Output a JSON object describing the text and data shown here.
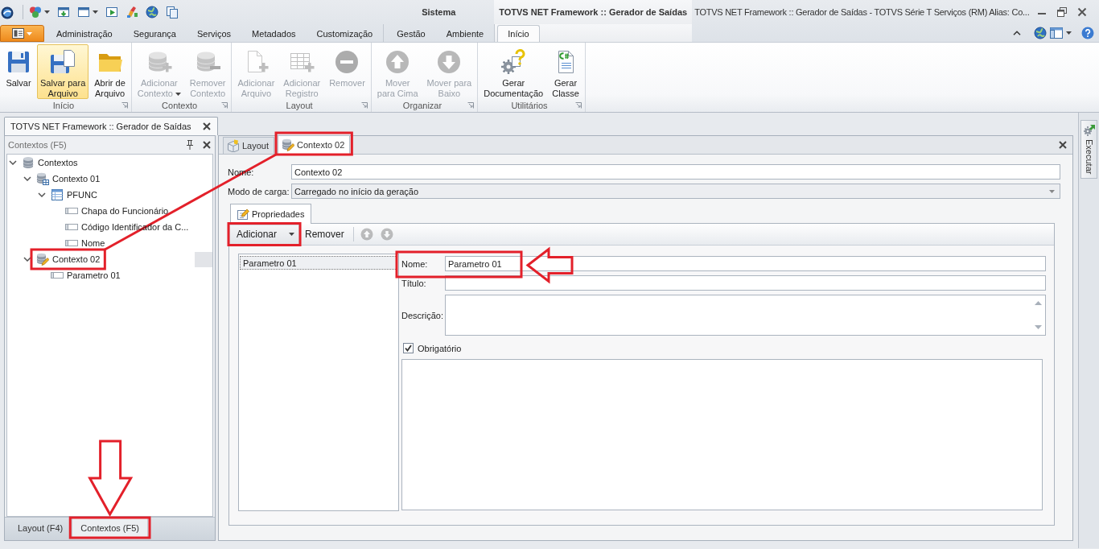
{
  "title_bar": {
    "title": "TOTVS NET Framework :: Gerador de Saídas - TOTVS Série T Serviços (RM) Alias: Co..."
  },
  "ribbon": {
    "tabs": [
      {
        "label": "Administração",
        "selected": false
      },
      {
        "label": "Segurança",
        "selected": false
      },
      {
        "label": "Serviços",
        "selected": false
      },
      {
        "label": "Metadados",
        "selected": false
      },
      {
        "label": "Customização",
        "selected": false
      }
    ],
    "tab_groups": [
      {
        "label": "Sistema",
        "tabs": [
          {
            "label": "Gestão",
            "selected": false
          },
          {
            "label": "Ambiente",
            "selected": false
          }
        ]
      },
      {
        "label": "TOTVS NET Framework :: Gerador de Saídas",
        "tabs": [
          {
            "label": "Início",
            "selected": true
          }
        ]
      }
    ],
    "groups": [
      {
        "label": "Início",
        "buttons": [
          {
            "label_lines": [
              "Salvar"
            ],
            "disabled": false,
            "highlighted": false,
            "dropdown": false
          },
          {
            "label_lines": [
              "Salvar para",
              "Arquivo"
            ],
            "disabled": false,
            "highlighted": true,
            "dropdown": false
          },
          {
            "label_lines": [
              "Abrir de",
              "Arquivo"
            ],
            "disabled": false,
            "highlighted": false,
            "dropdown": false
          }
        ]
      },
      {
        "label": "Contexto",
        "buttons": [
          {
            "label_lines": [
              "Adicionar",
              "Contexto"
            ],
            "disabled": true,
            "highlighted": false,
            "dropdown": true
          },
          {
            "label_lines": [
              "Remover",
              "Contexto"
            ],
            "disabled": true,
            "highlighted": false,
            "dropdown": false
          }
        ]
      },
      {
        "label": "Layout",
        "buttons": [
          {
            "label_lines": [
              "Adicionar",
              "Arquivo"
            ],
            "disabled": true,
            "highlighted": false,
            "dropdown": false
          },
          {
            "label_lines": [
              "Adicionar",
              "Registro"
            ],
            "disabled": true,
            "highlighted": false,
            "dropdown": false
          },
          {
            "label_lines": [
              "Remover"
            ],
            "disabled": true,
            "highlighted": false,
            "dropdown": false
          }
        ]
      },
      {
        "label": "Organizar",
        "buttons": [
          {
            "label_lines": [
              "Mover",
              "para Cima"
            ],
            "disabled": true,
            "highlighted": false,
            "dropdown": false
          },
          {
            "label_lines": [
              "Mover para",
              "Baixo"
            ],
            "disabled": true,
            "highlighted": false,
            "dropdown": false
          }
        ]
      },
      {
        "label": "Utilitários",
        "buttons": [
          {
            "label_lines": [
              "Gerar",
              "Documentação"
            ],
            "disabled": false,
            "highlighted": false,
            "dropdown": false
          },
          {
            "label_lines": [
              "Gerar",
              "Classe"
            ],
            "disabled": false,
            "highlighted": false,
            "dropdown": false
          }
        ]
      }
    ]
  },
  "document_tabs": [
    {
      "label": "TOTVS NET Framework :: Gerador de Saídas",
      "selected": true
    }
  ],
  "left_panel": {
    "title": "Contextos (F5)",
    "tree": [
      {
        "label": "Contextos",
        "kind": "root",
        "expanded": true,
        "selected": false,
        "children": [
          {
            "label": "Contexto 01",
            "kind": "datacontext",
            "expanded": true,
            "selected": false,
            "children": [
              {
                "label": "PFUNC",
                "kind": "table",
                "expanded": true,
                "selected": false,
                "children": [
                  {
                    "label": "Chapa do Funcionário",
                    "kind": "field",
                    "selected": false
                  },
                  {
                    "label": "Código Identificador da C...",
                    "kind": "field",
                    "selected": false
                  },
                  {
                    "label": "Nome",
                    "kind": "field",
                    "selected": false
                  }
                ]
              }
            ]
          },
          {
            "label": "Contexto 02",
            "kind": "paramcontext",
            "expanded": true,
            "selected": true,
            "children": [
              {
                "label": "Parametro 01",
                "kind": "field",
                "selected": false
              }
            ]
          }
        ]
      }
    ],
    "tabs": [
      {
        "label": "Layout (F4)",
        "selected": false
      },
      {
        "label": "Contextos (F5)",
        "selected": true
      }
    ]
  },
  "editor": {
    "tabs": [
      {
        "label": "Layout",
        "kind": "layout",
        "selected": false
      },
      {
        "label": "Contexto 02",
        "kind": "paramcontext",
        "selected": true
      }
    ],
    "fields": [
      {
        "label": "Nome:",
        "value": "Contexto 02",
        "kind": "text"
      },
      {
        "label": "Modo de carga:",
        "value": "Carregado no início da geração",
        "kind": "combo"
      }
    ],
    "sub_tabs": [
      {
        "label": "Propriedades",
        "selected": true
      }
    ],
    "toolbar": [
      {
        "label": "Adicionar",
        "kind": "menu"
      },
      {
        "label": "Remover",
        "kind": "button"
      }
    ],
    "move_buttons": [
      {
        "disabled": true
      },
      {
        "disabled": true
      }
    ],
    "parameters": [
      {
        "label": "Parametro 01",
        "selected": true
      }
    ],
    "parameter_form": {
      "fields": [
        {
          "label": "Nome:",
          "value": "Parametro 01",
          "kind": "text"
        },
        {
          "label": "Título:",
          "kind": "text"
        },
        {
          "label": "Descrição:",
          "kind": "memo"
        }
      ],
      "checkbox": {
        "label": "Obrigatório",
        "checked": true
      }
    }
  },
  "side_bar": {
    "tabs": [
      {
        "label": "Executar"
      }
    ]
  }
}
